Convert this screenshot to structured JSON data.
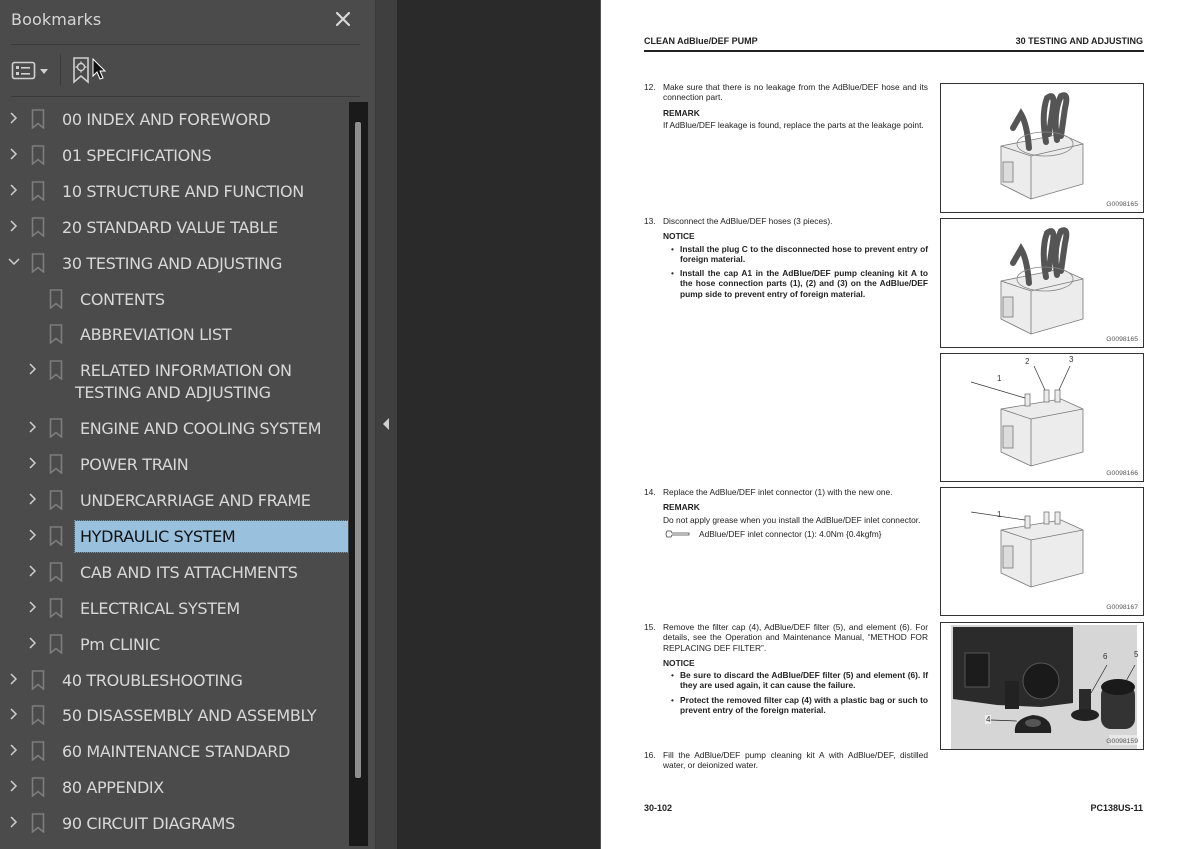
{
  "sidebar": {
    "title": "Bookmarks",
    "close_icon": "close-icon",
    "toolbar": {
      "options_icon": "list-options-icon",
      "options_dropdown_icon": "caret-down-icon",
      "bookmark_action_icon": "bookmark-target-icon"
    },
    "items": [
      {
        "label": "00 INDEX AND FOREWORD",
        "level": 0,
        "expandable": true,
        "expanded": false
      },
      {
        "label": "01 SPECIFICATIONS",
        "level": 0,
        "expandable": true,
        "expanded": false
      },
      {
        "label": "10 STRUCTURE AND FUNCTION",
        "level": 0,
        "expandable": true,
        "expanded": false
      },
      {
        "label": "20 STANDARD VALUE TABLE",
        "level": 0,
        "expandable": true,
        "expanded": false
      },
      {
        "label": "30 TESTING AND ADJUSTING",
        "level": 0,
        "expandable": true,
        "expanded": true
      },
      {
        "label": "CONTENTS",
        "level": 1,
        "expandable": false
      },
      {
        "label": "ABBREVIATION LIST",
        "level": 1,
        "expandable": false
      },
      {
        "label": "RELATED INFORMATION ON",
        "label_line2": "TESTING AND ADJUSTING",
        "level": 1,
        "expandable": true,
        "expanded": false
      },
      {
        "label": "ENGINE AND COOLING SYSTEM",
        "level": 1,
        "expandable": true,
        "expanded": false
      },
      {
        "label": "POWER TRAIN",
        "level": 1,
        "expandable": true,
        "expanded": false
      },
      {
        "label": "UNDERCARRIAGE AND FRAME",
        "level": 1,
        "expandable": true,
        "expanded": false
      },
      {
        "label": "HYDRAULIC SYSTEM",
        "level": 1,
        "expandable": true,
        "expanded": false,
        "selected": true
      },
      {
        "label": "CAB AND ITS ATTACHMENTS",
        "level": 1,
        "expandable": true,
        "expanded": false
      },
      {
        "label": "ELECTRICAL SYSTEM",
        "level": 1,
        "expandable": true,
        "expanded": false
      },
      {
        "label": "Pm CLINIC",
        "level": 1,
        "expandable": true,
        "expanded": false
      },
      {
        "label": "40 TROUBLESHOOTING",
        "level": 0,
        "expandable": true,
        "expanded": false
      },
      {
        "label": "50 DISASSEMBLY AND ASSEMBLY",
        "level": 0,
        "expandable": true,
        "expanded": false
      },
      {
        "label": "60 MAINTENANCE STANDARD",
        "level": 0,
        "expandable": true,
        "expanded": false
      },
      {
        "label": "80 APPENDIX",
        "level": 0,
        "expandable": true,
        "expanded": false
      },
      {
        "label": "90 CIRCUIT DIAGRAMS",
        "level": 0,
        "expandable": true,
        "expanded": false
      }
    ],
    "selected_color": "#99c0dc"
  },
  "viewer": {
    "collapse_icon": "triangle-left-icon"
  },
  "page": {
    "header_left": "CLEAN AdBlue/DEF PUMP",
    "header_right": "30 TESTING AND ADJUSTING",
    "steps": {
      "s12": {
        "num": "12.",
        "text": "Make sure that there is no leakage from the AdBlue/DEF hose and its connection part.",
        "remark_head": "REMARK",
        "remark_text": "If AdBlue/DEF leakage is found, replace the parts at the leakage point."
      },
      "s13": {
        "num": "13.",
        "text": "Disconnect the AdBlue/DEF hoses (3 pieces).",
        "notice_head": "NOTICE",
        "bullets": [
          "Install the plug C to the disconnected hose to prevent entry of foreign material.",
          "Install the cap A1 in the AdBlue/DEF pump cleaning kit A to the hose connection parts (1), (2) and (3) on the AdBlue/DEF pump side to prevent entry of foreign material."
        ]
      },
      "s14": {
        "num": "14.",
        "text": "Replace the AdBlue/DEF inlet connector (1) with the new one.",
        "remark_head": "REMARK",
        "remark_text": "Do not apply grease when you install the AdBlue/DEF inlet connector.",
        "torque_text": "AdBlue/DEF inlet connector (1): 4.0Nm {0.4kgfm}"
      },
      "s15": {
        "num": "15.",
        "text": "Remove the filter cap (4), AdBlue/DEF filter (5), and element (6). For details, see the Operation and Maintenance Manual, “METHOD FOR REPLACING DEF FILTER”.",
        "notice_head": "NOTICE",
        "bullets": [
          "Be sure to discard the AdBlue/DEF filter (5) and element (6). If they are used again, it can cause the failure.",
          "Protect the removed filter cap (4) with a plastic bag or such to prevent entry of the foreign material."
        ]
      },
      "s16": {
        "num": "16.",
        "text": "Fill the AdBlue/DEF pump cleaning kit A with AdBlue/DEF, distilled water, or deionized water."
      }
    },
    "figures": [
      {
        "code": "G0098165"
      },
      {
        "code": "G0098165"
      },
      {
        "code": "G0098166",
        "callouts": [
          "1",
          "2",
          "3"
        ]
      },
      {
        "code": "G0098167",
        "callouts": [
          "1"
        ]
      },
      {
        "code": "G0098159",
        "callouts": [
          "4",
          "5",
          "6"
        ]
      }
    ],
    "footer_left": "30-102",
    "footer_right": "PC138US-11"
  }
}
